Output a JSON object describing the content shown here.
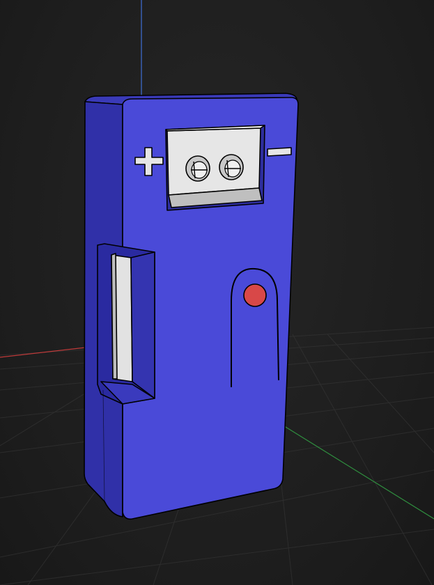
{
  "viewport": {
    "background": "#1f1f1f",
    "grid_color": "#3a3a3a"
  },
  "axes": {
    "x_color": "#c03a3a",
    "y_color": "#2f8f3f",
    "z_color": "#3f6fd8"
  },
  "model": {
    "body_color": "#4848c8",
    "face_color": "#4a4ad8",
    "side_color": "#3030a8",
    "outline_color": "#000000",
    "terminal_color": "#e6e6e6",
    "button_color": "#d84848",
    "plus_symbol": "+",
    "minus_symbol": "−"
  }
}
